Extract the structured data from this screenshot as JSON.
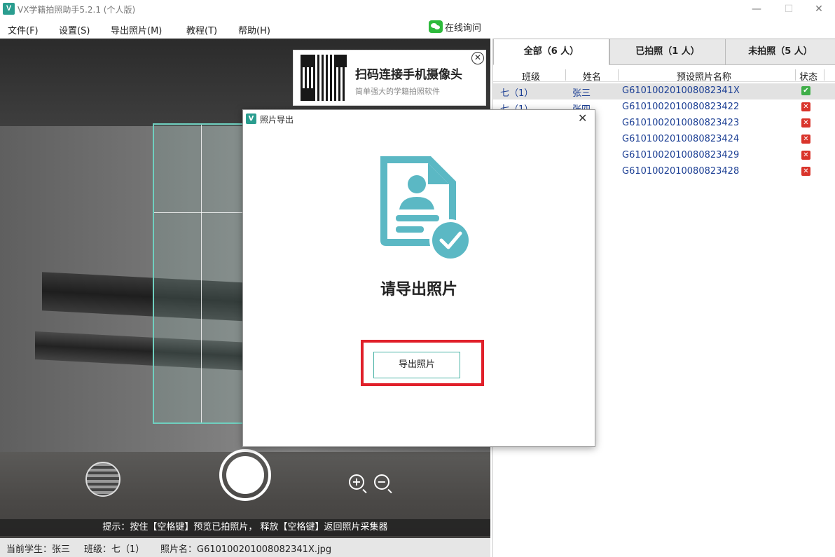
{
  "window": {
    "logo": "V",
    "title": "VX学籍拍照助手5.2.1 (个人版)",
    "minimize": "—",
    "maximize": "☐",
    "close": "✕"
  },
  "menu": {
    "items": [
      "文件(F)",
      "设置(S)",
      "导出照片(M)",
      "教程(T)",
      "帮助(H)"
    ],
    "online": "在线询问"
  },
  "camera": {
    "qr_title": "扫码连接手机摄像头",
    "qr_subtitle": "简单强大的学籍拍照软件",
    "qr_close": "✕",
    "zoom_in": "+",
    "zoom_out": "−",
    "hint": "提示：按住【空格键】预览已拍照片， 释放【空格键】返回照片采集器"
  },
  "status": {
    "current_student": "当前学生：张三",
    "class": "班级：七（1）",
    "photo_name": "照片名：G610100201008082341X.jpg"
  },
  "tabs": [
    {
      "label": "全部（6 人）",
      "active": true
    },
    {
      "label": "已拍照（1 人）",
      "active": false
    },
    {
      "label": "未拍照（5 人）",
      "active": false
    }
  ],
  "table": {
    "headers": [
      "班级",
      "姓名",
      "预设照片名称",
      "状态"
    ],
    "rows": [
      {
        "class": "七（1）",
        "name": "张三",
        "photo": "G610100201008082341X",
        "status": "ok"
      },
      {
        "class": "七（1）",
        "name": "张四",
        "photo": "G6101002010080823422",
        "status": "no"
      },
      {
        "class": "",
        "name": "",
        "photo": "G6101002010080823423",
        "status": "no"
      },
      {
        "class": "",
        "name": "",
        "photo": "G6101002010080823424",
        "status": "no"
      },
      {
        "class": "",
        "name": "",
        "photo": "G6101002010080823429",
        "status": "no"
      },
      {
        "class": "",
        "name": "",
        "photo": "G6101002010080823428",
        "status": "no"
      }
    ]
  },
  "dialog": {
    "logo": "V",
    "title": "照片导出",
    "close": "✕",
    "heading": "请导出照片",
    "button": "导出照片"
  },
  "colors": {
    "accent": "#2a9d8f",
    "icon": "#5bb8c4",
    "highlight": "#e0202a",
    "ok": "#3fae49",
    "no": "#d9342b"
  }
}
